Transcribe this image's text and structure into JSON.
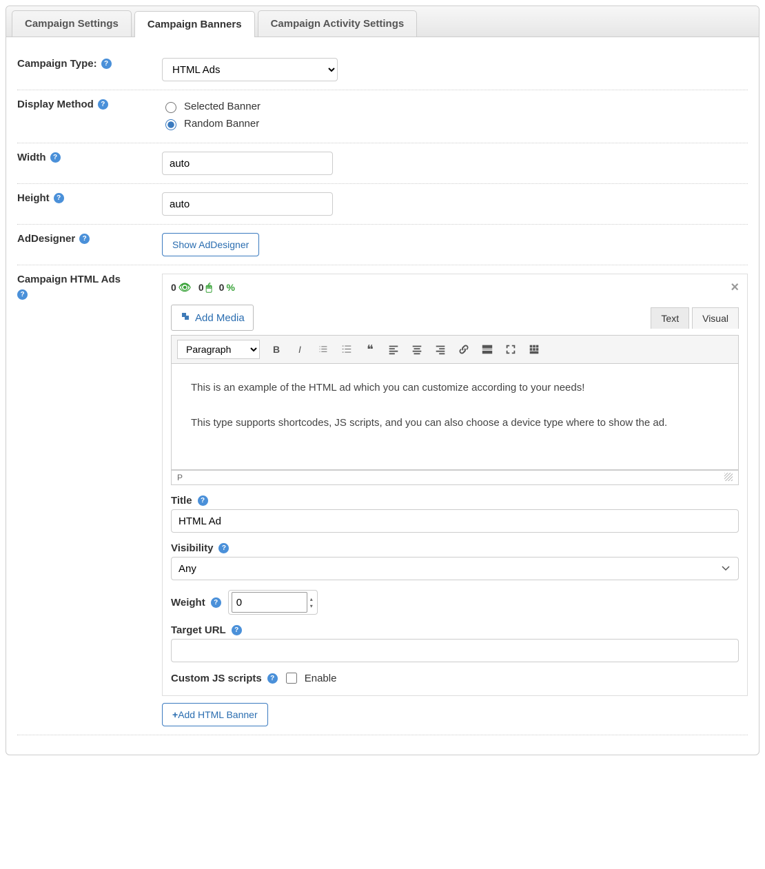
{
  "tabs": [
    "Campaign Settings",
    "Campaign Banners",
    "Campaign Activity Settings"
  ],
  "activeTab": 1,
  "labels": {
    "campaignType": "Campaign Type:",
    "displayMethod": "Display Method",
    "width": "Width",
    "height": "Height",
    "adDesigner": "AdDesigner",
    "htmlAds": "Campaign HTML Ads"
  },
  "campaignType": {
    "value": "HTML Ads",
    "options": [
      "HTML Ads"
    ]
  },
  "displayMethod": {
    "options": [
      "Selected Banner",
      "Random Banner"
    ],
    "selected": "Random Banner"
  },
  "width": "auto",
  "height": "auto",
  "adDesignerButton": "Show AdDesigner",
  "stats": {
    "views": 0,
    "clicks": 0,
    "ctr": 0
  },
  "addMedia": "Add Media",
  "editorTabs": {
    "text": "Text",
    "visual": "Visual",
    "active": "text"
  },
  "toolbar": {
    "formatSelect": "Paragraph"
  },
  "editorContent": "This is an example of the HTML ad which you can customize according to your needs!\n\nThis type supports shortcodes, JS scripts, and you can also choose a device type where to show the ad.",
  "pathBar": "P",
  "sub": {
    "titleLabel": "Title",
    "titleValue": "HTML Ad",
    "visibilityLabel": "Visibility",
    "visibilityValue": "Any",
    "weightLabel": "Weight",
    "weightValue": "0",
    "targetLabel": "Target URL",
    "targetValue": "",
    "customJsLabel": "Custom JS scripts",
    "enableLabel": "Enable"
  },
  "addBannerBtn": "Add HTML Banner"
}
